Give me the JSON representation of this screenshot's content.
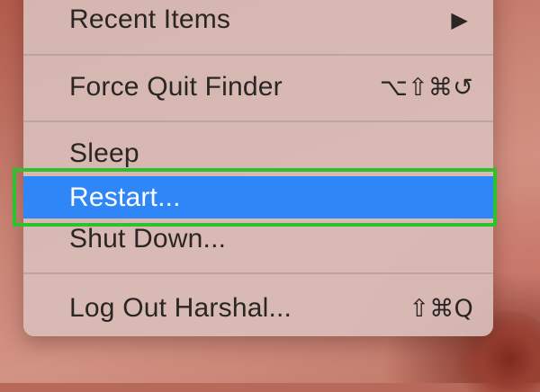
{
  "menu": {
    "items": [
      {
        "label": "Recent Items",
        "shortcut": "",
        "submenu_arrow": "▶"
      },
      {
        "label": "Force Quit Finder",
        "shortcut": "⌥⇧⌘↺"
      },
      {
        "label": "Sleep",
        "shortcut": ""
      },
      {
        "label": "Restart...",
        "shortcut": "",
        "selected": true
      },
      {
        "label": "Shut Down...",
        "shortcut": ""
      },
      {
        "label": "Log Out Harshal...",
        "shortcut": "⇧⌘Q"
      }
    ]
  },
  "colors": {
    "selection": "#2f86f6",
    "highlight_box": "#2ec12e",
    "menu_text": "#2a2624"
  },
  "icons": {
    "submenu": "chevron-right-icon"
  }
}
